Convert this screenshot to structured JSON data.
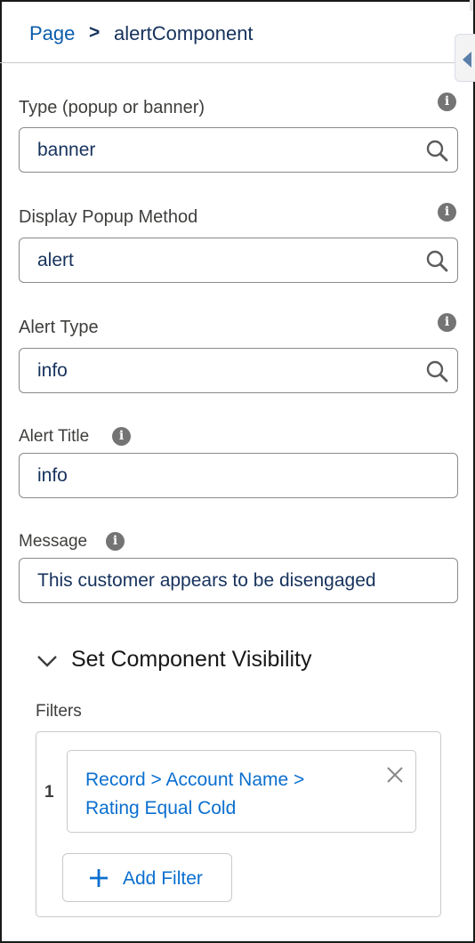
{
  "breadcrumb": {
    "page": "Page",
    "separator": ">",
    "current": "alertComponent"
  },
  "fields": [
    {
      "label": "Type (popup or banner)",
      "value": "banner",
      "has_search": true
    },
    {
      "label": "Display Popup Method",
      "value": "alert",
      "has_search": true
    },
    {
      "label": "Alert Type",
      "value": "info",
      "has_search": true
    },
    {
      "label": "Alert Title",
      "value": "info",
      "has_search": false
    },
    {
      "label": "Message",
      "value": "This customer appears to be disengaged",
      "has_search": false
    }
  ],
  "info_glyph": "i",
  "visibility": {
    "title": "Set Component Visibility",
    "filters_label": "Filters",
    "filters": [
      {
        "index": "1",
        "line1": "Record > Account Name >",
        "line2": "Rating Equal Cold"
      }
    ],
    "add_filter_label": "Add Filter"
  },
  "icons": {
    "search": "search-icon",
    "info": "info-icon",
    "chevron": "chevron-down-icon",
    "close": "close-icon",
    "plus": "plus-icon",
    "collapse": "chevron-left-icon"
  },
  "colors": {
    "link": "#0b5cab",
    "value_text": "#16325c",
    "filter_link": "#0b6fcf",
    "label": "#3e3e3c"
  }
}
